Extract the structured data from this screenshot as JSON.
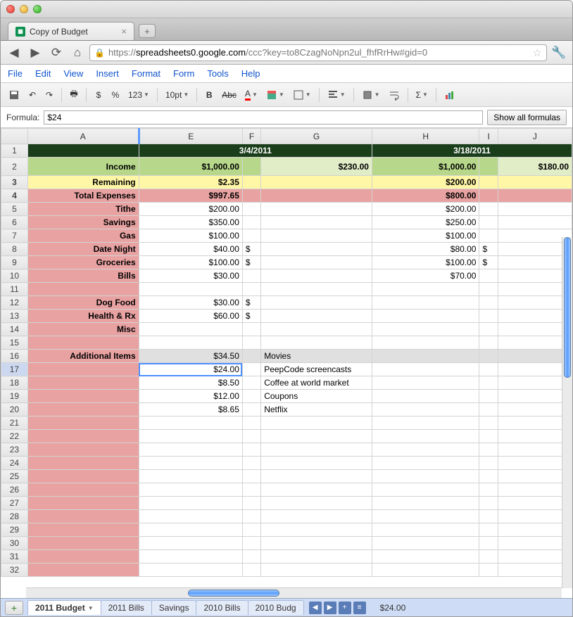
{
  "window": {
    "tab_title": "Copy of Budget"
  },
  "url": {
    "scheme": "https://",
    "host": "spreadsheets0.google.com",
    "path": "/ccc?key=to8CzagNoNpn2ul_fhfRrHw#gid=0"
  },
  "menus": [
    "File",
    "Edit",
    "View",
    "Insert",
    "Format",
    "Form",
    "Tools",
    "Help"
  ],
  "toolbar": {
    "dollar": "$",
    "percent": "%",
    "more_fmt": "123",
    "fontsize": "10pt",
    "bold": "B",
    "strike": "Abc",
    "textcolor": "A"
  },
  "formula": {
    "label": "Formula:",
    "value": "$24",
    "show_all": "Show all formulas"
  },
  "columns": [
    "A",
    "E",
    "F",
    "G",
    "H",
    "I",
    "J"
  ],
  "row_headers": [
    1,
    2,
    3,
    4,
    5,
    6,
    7,
    8,
    9,
    10,
    11,
    12,
    13,
    14,
    15,
    16,
    17,
    18,
    19,
    20,
    21,
    22,
    23,
    24,
    25,
    26,
    27,
    28,
    29,
    30,
    31,
    32
  ],
  "dates": {
    "left": "3/4/2011",
    "right": "3/18/2011"
  },
  "labels": {
    "income": "Income",
    "remaining": "Remaining",
    "total_expenses": "Total Expenses",
    "tithe": "Tithe",
    "savings": "Savings",
    "gas": "Gas",
    "date_night": "Date Night",
    "groceries": "Groceries",
    "bills": "Bills",
    "dog_food": "Dog Food",
    "health_rx": "Health & Rx",
    "misc": "Misc",
    "additional": "Additional Items"
  },
  "left_period": {
    "income": "$1,000.00",
    "income2": "$230.00",
    "remaining": "$2.35",
    "total": "$997.65",
    "tithe": "$200.00",
    "savings": "$350.00",
    "gas": "$100.00",
    "date_night": "$40.00",
    "date_night_f": "$",
    "groceries": "$100.00",
    "groceries_f": "$",
    "bills": "$30.00",
    "dog_food": "$30.00",
    "dog_food_f": "$",
    "health_rx": "$60.00",
    "health_rx_f": "$"
  },
  "right_period": {
    "income": "$1,000.00",
    "income2": "$180.00",
    "remaining": "$200.00",
    "total": "$800.00",
    "tithe": "$200.00",
    "savings": "$250.00",
    "gas": "$100.00",
    "date_night": "$80.00",
    "date_night_f": "$",
    "groceries": "$100.00",
    "groceries_f": "$",
    "bills": "$70.00"
  },
  "additional": [
    {
      "amount": "$34.50",
      "desc": "Movies"
    },
    {
      "amount": "$24.00",
      "desc": "PeepCode screencasts"
    },
    {
      "amount": "$8.50",
      "desc": "Coffee at world market"
    },
    {
      "amount": "$12.00",
      "desc": "Coupons"
    },
    {
      "amount": "$8.65",
      "desc": "Netflix"
    }
  ],
  "sheets": {
    "active": "2011 Budget",
    "others": [
      "2011 Bills",
      "Savings",
      "2010 Bills",
      "2010 Budg"
    ]
  },
  "statusbar": "$24.00"
}
